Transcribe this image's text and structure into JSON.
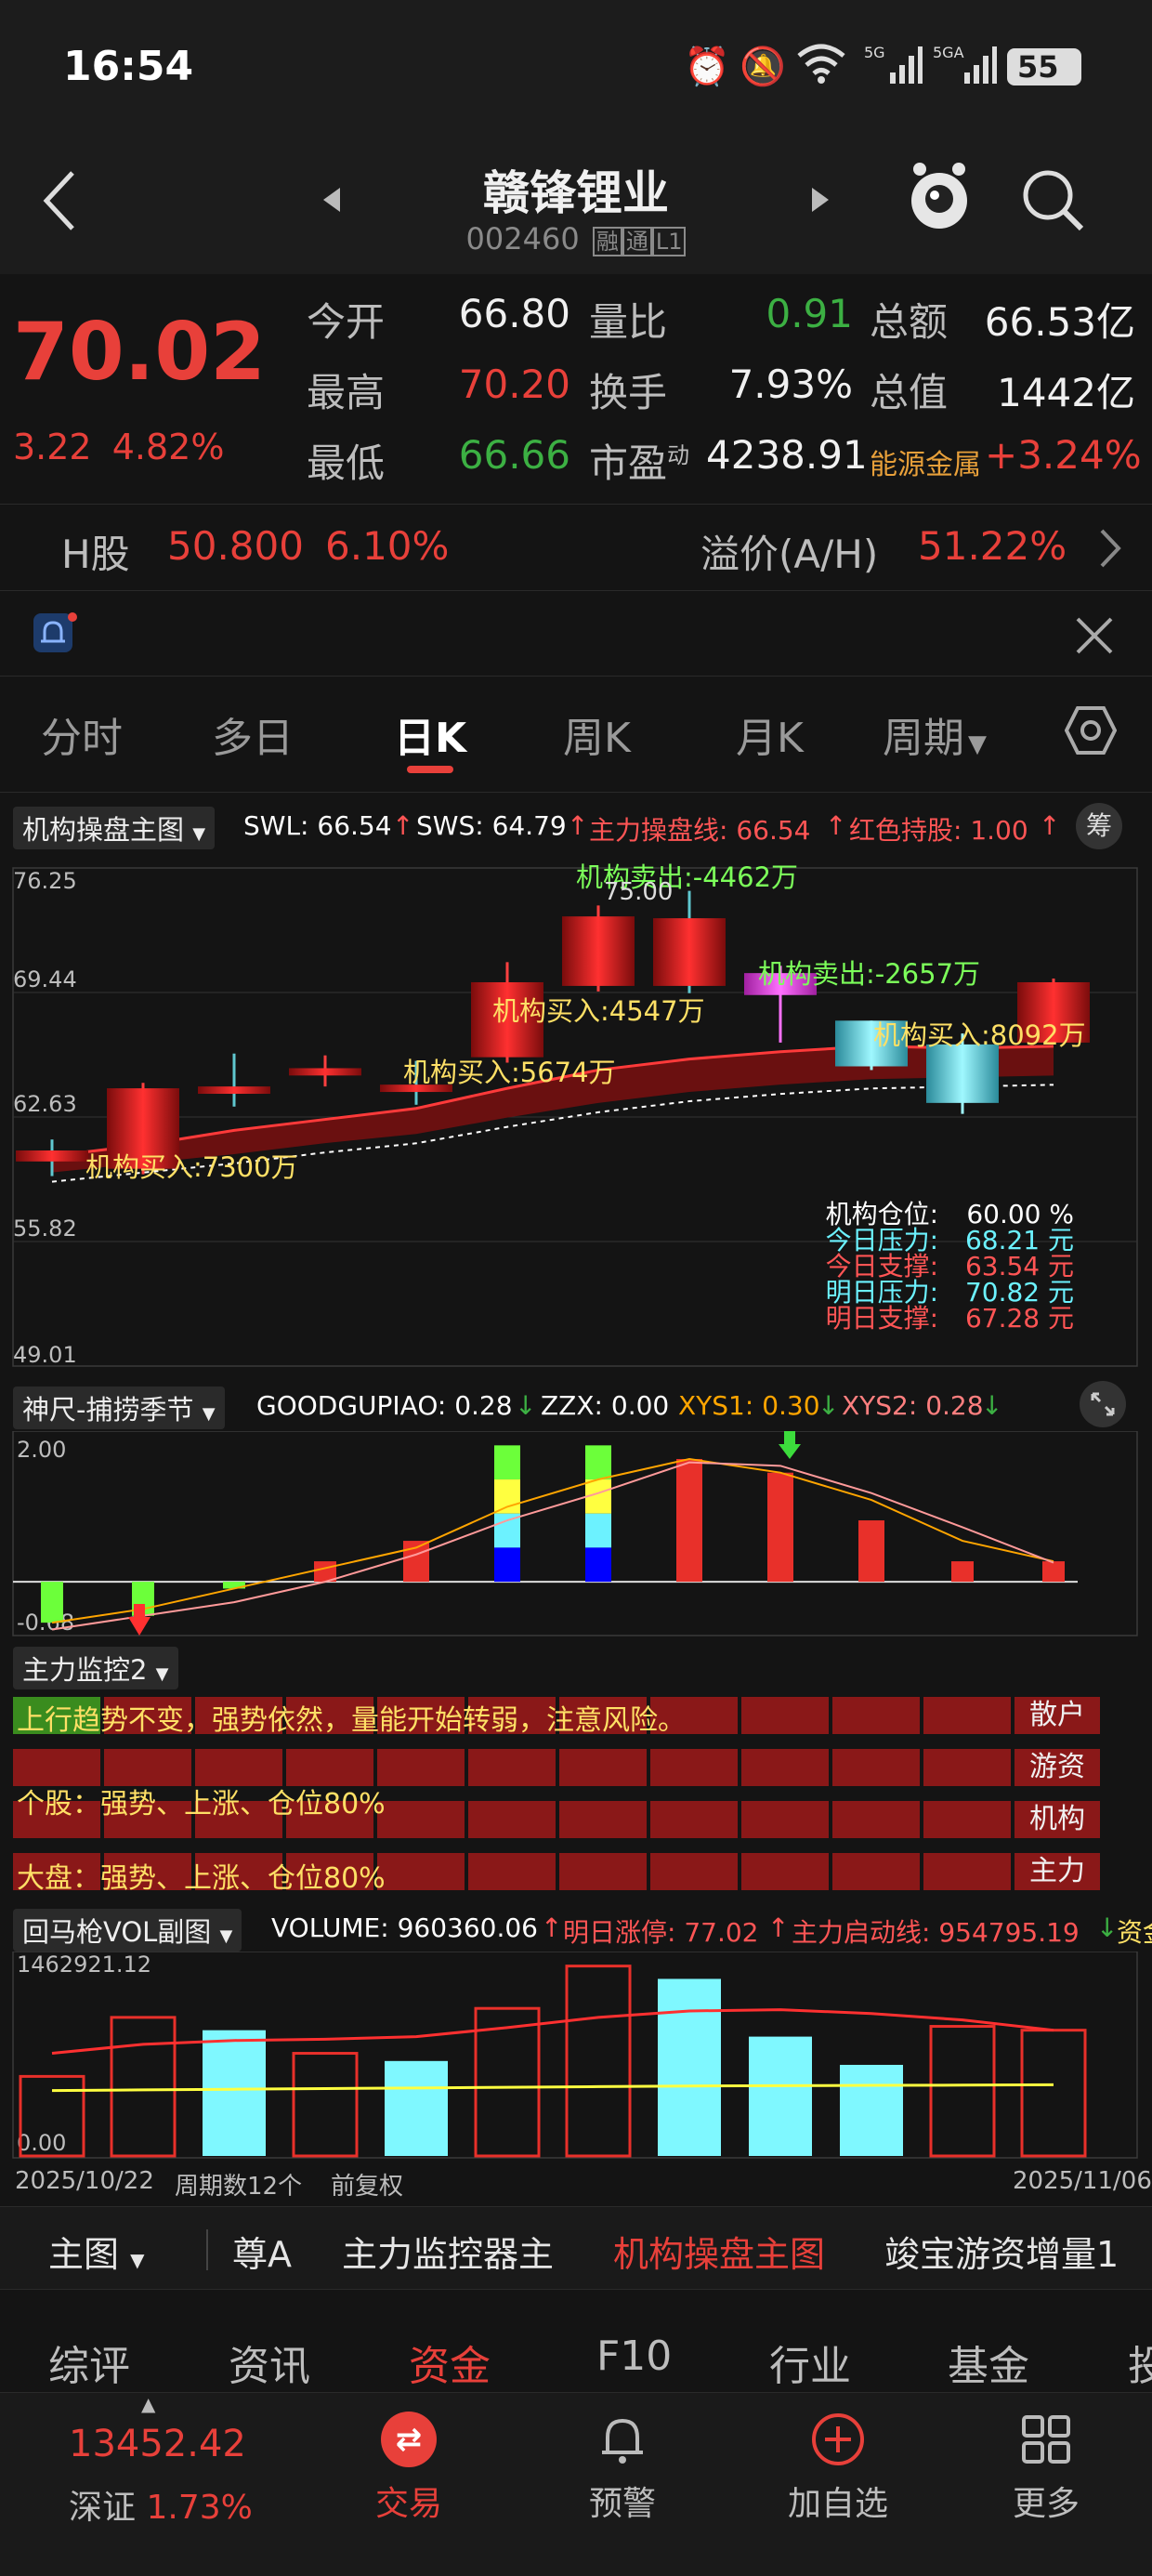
{
  "status_bar": {
    "time": "16:54",
    "battery": "55"
  },
  "header": {
    "title": "赣锋锂业",
    "code": "002460",
    "badges": [
      "融",
      "通",
      "L1"
    ]
  },
  "quote": {
    "price": "70.02",
    "change": "3.22",
    "change_pct": "4.82%",
    "rows": [
      {
        "l1": "今开",
        "v1": "66.80",
        "l2": "量比",
        "v2": "0.91",
        "l3": "总额",
        "v3": "66.53亿"
      },
      {
        "l1": "最高",
        "v1": "70.20",
        "l2": "换手",
        "v2": "7.93%",
        "l3": "总值",
        "v3": "1442亿"
      },
      {
        "l1": "最低",
        "v1": "66.66",
        "l2": "市盈",
        "l2_sup": "动",
        "v2": "4238.91",
        "l3": "能源金属",
        "v3": "+3.24%"
      }
    ]
  },
  "h_share": {
    "label": "H股",
    "price": "50.800",
    "pct": "6.10%",
    "premium_label": "溢价(A/H)",
    "premium": "51.22%"
  },
  "tabs": [
    "分时",
    "多日",
    "日K",
    "周K",
    "月K",
    "周期"
  ],
  "active_tab": "日K",
  "main_chart": {
    "selector": "机构操盘主图",
    "params": [
      {
        "text": "SWL: 66.54",
        "arrow": "↑",
        "color": "#ffffff"
      },
      {
        "text": "SWS: 64.79",
        "arrow": "↑",
        "color": "#ffffff"
      },
      {
        "text": "主力操盘线: 66.54",
        "arrow": "↑",
        "color": "#ff5555"
      },
      {
        "text": "红色持股: 1.00",
        "arrow": "↑",
        "color": "#ff5555"
      }
    ],
    "chip_btn": "筹",
    "y_ticks": [
      "76.25",
      "69.44",
      "62.63",
      "55.82",
      "49.01"
    ],
    "peak_label": "75.00",
    "annotations": [
      {
        "text": "机构卖出:-4462万",
        "color": "#7cff5a"
      },
      {
        "text": "机构卖出:-2657万",
        "color": "#7cff5a"
      },
      {
        "text": "机构买入:4547万",
        "color": "#ffe066"
      },
      {
        "text": "机构买入:5674万",
        "color": "#ffe066"
      },
      {
        "text": "机构买入:8092万",
        "color": "#ffe066"
      },
      {
        "text": "机构买入:7300万",
        "color": "#ffe066"
      }
    ],
    "info_panel": [
      {
        "label": "机构仓位:",
        "value": "60.00 %",
        "color": "#ffffff"
      },
      {
        "label": "今日压力:",
        "value": "68.21 元",
        "color": "#6cf2ff"
      },
      {
        "label": "今日支撑:",
        "value": "63.54 元",
        "color": "#ff5555"
      },
      {
        "label": "明日压力:",
        "value": "70.82 元",
        "color": "#6cf2ff"
      },
      {
        "label": "明日支撑:",
        "value": "67.28 元",
        "color": "#ff5555"
      }
    ],
    "candles": [
      {
        "o": 60.8,
        "c": 60.2,
        "h": 61.4,
        "l": 59.4,
        "style": "red"
      },
      {
        "o": 59.8,
        "c": 64.2,
        "h": 64.5,
        "l": 59.5,
        "style": "red"
      },
      {
        "o": 64.3,
        "c": 63.9,
        "h": 66.1,
        "l": 63.2,
        "style": "red"
      },
      {
        "o": 64.9,
        "c": 65.3,
        "h": 66.0,
        "l": 64.3,
        "style": "red"
      },
      {
        "o": 64.4,
        "c": 64.0,
        "h": 65.7,
        "l": 63.3,
        "style": "red"
      },
      {
        "o": 65.9,
        "c": 70.0,
        "h": 71.1,
        "l": 65.6,
        "style": "red"
      },
      {
        "o": 69.8,
        "c": 73.6,
        "h": 74.2,
        "l": 69.5,
        "style": "red"
      },
      {
        "o": 73.5,
        "c": 69.8,
        "h": 75.0,
        "l": 69.4,
        "style": "red"
      },
      {
        "o": 70.5,
        "c": 69.3,
        "h": 70.9,
        "l": 66.7,
        "style": "magenta"
      },
      {
        "o": 67.9,
        "c": 65.4,
        "h": 67.9,
        "l": 65.2,
        "style": "cyan"
      },
      {
        "o": 66.6,
        "c": 63.4,
        "h": 67.2,
        "l": 62.8,
        "style": "cyan"
      },
      {
        "o": 66.7,
        "c": 70.0,
        "h": 70.2,
        "l": 66.7,
        "style": "red"
      }
    ],
    "band_upper": [
      60.5,
      61.1,
      61.9,
      62.5,
      63.1,
      64.2,
      65.2,
      65.8,
      66.2,
      66.5,
      66.4,
      66.5
    ],
    "band_lower": [
      59.6,
      60.1,
      60.6,
      61.2,
      61.7,
      62.6,
      63.4,
      64.0,
      64.4,
      64.7,
      64.8,
      64.9
    ]
  },
  "sub1": {
    "selector": "神尺-捕捞季节",
    "params": [
      {
        "text": "GOODGUPIAO: 0.28",
        "arrow": "↓",
        "color": "#ffffff"
      },
      {
        "text": "ZZX: 0.00",
        "arrow": "",
        "color": "#ffffff"
      },
      {
        "text": "XYS1: 0.30",
        "arrow": "↓",
        "color": "#ffa500"
      },
      {
        "text": "XYS2: 0.28",
        "arrow": "↓",
        "color": "#ff7f7f"
      }
    ],
    "y_ticks": [
      "2.00",
      "-0.68"
    ],
    "bars": [
      -0.6,
      -0.5,
      -0.1,
      0.3,
      0.6,
      2.0,
      2.0,
      1.8,
      1.6,
      0.9,
      0.3,
      0.3
    ],
    "xys1": [
      -0.6,
      -0.4,
      -0.1,
      0.2,
      0.5,
      1.1,
      1.5,
      1.8,
      1.6,
      1.2,
      0.6,
      0.3
    ],
    "xys2": [
      -0.7,
      -0.5,
      -0.3,
      0.0,
      0.4,
      0.9,
      1.3,
      1.75,
      1.7,
      1.3,
      0.8,
      0.28
    ]
  },
  "monitor": {
    "selector": "主力监控2",
    "line1": "上行趋势不变，强势依然，量能开始转弱，注意风险。",
    "line2": "个股：强势、上涨、仓位80%",
    "line3": "大盘：强势、上涨、仓位80%",
    "labels": [
      "散户",
      "游资",
      "机构",
      "主力"
    ]
  },
  "volume": {
    "selector": "回马枪VOL副图",
    "params": [
      {
        "text": "VOLUME: 960360.06",
        "arrow": "↑",
        "color": "#ffffff"
      },
      {
        "text": "明日涨停: 77.02",
        "arrow": "↑",
        "color": "#ff5555"
      },
      {
        "text": "主力启动线: 954795.19",
        "arrow": "↓",
        "color": "#ff5555"
      },
      {
        "text": "资金",
        "arrow": "",
        "color": "#ffe066"
      }
    ],
    "y_ticks": [
      "1462921.12",
      "0.00"
    ],
    "bars": [
      620000,
      1080000,
      980000,
      800000,
      740000,
      1150000,
      1480000,
      1380000,
      930000,
      710000,
      1010000,
      980000
    ],
    "bar_style": [
      "red",
      "red",
      "cyan",
      "red",
      "cyan",
      "red",
      "red",
      "cyan",
      "cyan",
      "cyan",
      "red",
      "red"
    ],
    "ma_red": [
      800000,
      870000,
      900000,
      910000,
      930000,
      1000000,
      1080000,
      1130000,
      1140000,
      1110000,
      1060000,
      980000
    ],
    "ma_yellow": [
      510000,
      515000,
      520000,
      525000,
      530000,
      535000,
      540000,
      545000,
      548000,
      550000,
      552000,
      555000
    ],
    "date_start": "2025/10/22",
    "period_count": "周期数12个",
    "adjust": "前复权",
    "date_end": "2025/11/06"
  },
  "indicator_bar": {
    "main": "主图",
    "items": [
      "尊A",
      "主力监控器主",
      "机构操盘主图",
      "竣宝游资增量1"
    ],
    "active": "机构操盘主图"
  },
  "bottom_tabs": [
    "综评",
    "资讯",
    "资金",
    "F10",
    "行业",
    "基金",
    "投"
  ],
  "bottom_tab_active": "资金",
  "footer": {
    "index_value": "13452.42",
    "index_name": "深证",
    "index_pct": "1.73%",
    "nav": [
      {
        "label": "交易"
      },
      {
        "label": "预警"
      },
      {
        "label": "加自选"
      },
      {
        "label": "更多"
      }
    ]
  },
  "colors": {
    "up": "#e8403a",
    "down": "#3cb043",
    "accent": "#e8403a",
    "bg": "#141414"
  }
}
